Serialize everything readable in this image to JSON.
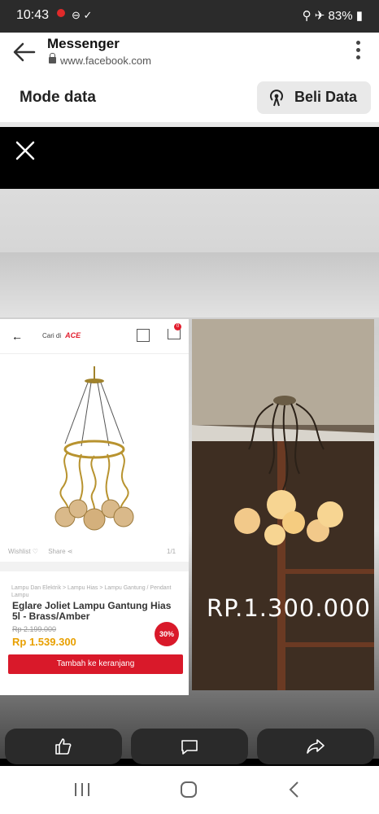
{
  "status": {
    "time": "10:43",
    "icons": "⊖ ✓",
    "battery": "83%",
    "right_icons": "⚲ ✈"
  },
  "browser": {
    "title": "Messenger",
    "url": "www.facebook.com"
  },
  "data_bar": {
    "mode_label": "Mode data",
    "buy_label": "Beli Data"
  },
  "product": {
    "search_prefix": "Cari di",
    "store_logo": "ACE",
    "cart_count": "0",
    "wishlist": "Wishlist",
    "share": "Share",
    "image_count": "1/1",
    "breadcrumb": "Lampu Dan Elektrik > Lampu Hias > Lampu Gantung / Pendant Lampu",
    "name": "Eglare Joliet Lampu Gantung Hias 5l - Brass/Amber",
    "old_price": "Rp 2.199.000",
    "new_price": "Rp 1.539.300",
    "discount": "30%",
    "add_cart": "Tambah ke keranjang"
  },
  "overlay": {
    "price": "RP.1.300.000"
  },
  "actions": {
    "like": "thumbs-up-icon",
    "comment": "comment-icon",
    "share": "share-icon"
  },
  "colors": {
    "accent_red": "#d9192a",
    "price_orange": "#e8a000",
    "status_bar": "#2b2b2b"
  }
}
